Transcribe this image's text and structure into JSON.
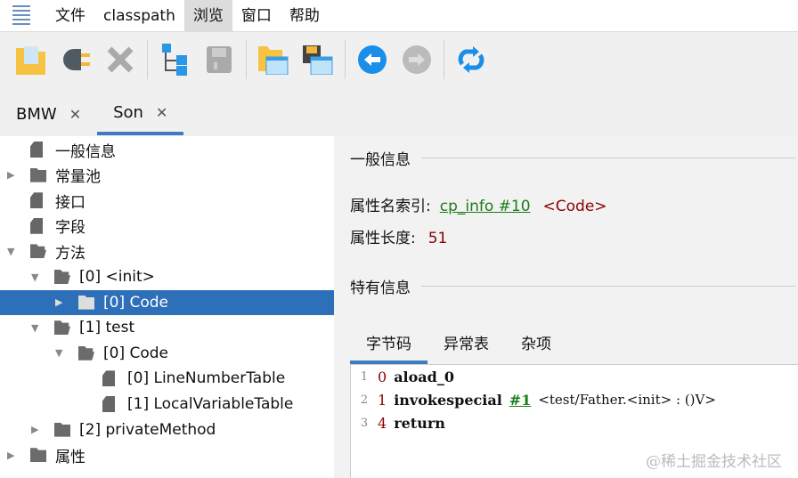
{
  "menu": [
    "文件",
    "classpath",
    "浏览",
    "窗口",
    "帮助"
  ],
  "toolbar": [
    "open-icon",
    "plug-icon",
    "close-icon",
    "tree-icon",
    "save-icon",
    "open-window-icon",
    "save-window-icon",
    "back-icon",
    "forward-icon",
    "refresh-icon"
  ],
  "tabs": [
    {
      "label": "BMW"
    },
    {
      "label": "Son"
    }
  ],
  "close_glyph": "✕",
  "tree": [
    {
      "label": "一般信息",
      "level": 0,
      "icon": "file",
      "arrow": ""
    },
    {
      "label": "常量池",
      "level": 0,
      "icon": "folder",
      "arrow": "▶"
    },
    {
      "label": "接口",
      "level": 0,
      "icon": "file",
      "arrow": ""
    },
    {
      "label": "字段",
      "level": 0,
      "icon": "file",
      "arrow": ""
    },
    {
      "label": "方法",
      "level": 0,
      "icon": "ofolder",
      "arrow": "▼"
    },
    {
      "label": "[0] <init>",
      "level": 1,
      "icon": "ofolder",
      "arrow": "▼"
    },
    {
      "label": "[0] Code",
      "level": 2,
      "icon": "folder",
      "arrow": "▶",
      "selected": true
    },
    {
      "label": "[1] test",
      "level": 1,
      "icon": "ofolder",
      "arrow": "▼"
    },
    {
      "label": "[0] Code",
      "level": 2,
      "icon": "ofolder",
      "arrow": "▼"
    },
    {
      "label": "[0] LineNumberTable",
      "level": 3,
      "icon": "file",
      "arrow": ""
    },
    {
      "label": "[1] LocalVariableTable",
      "level": 3,
      "icon": "file",
      "arrow": ""
    },
    {
      "label": "[2] privateMethod",
      "level": 1,
      "icon": "folder",
      "arrow": "▶"
    },
    {
      "label": "属性",
      "level": 0,
      "icon": "folder",
      "arrow": "▶"
    }
  ],
  "general": {
    "title": "一般信息",
    "name_index_label": "属性名索引:",
    "name_index_link": "cp_info #10",
    "name_index_value": "<Code>",
    "length_label": "属性长度:",
    "length_value": "51"
  },
  "specific": {
    "title": "特有信息"
  },
  "subtabs": [
    "字节码",
    "异常表",
    "杂项"
  ],
  "code": [
    {
      "line": "1",
      "offset": "0",
      "op": "aload_0",
      "ref": "",
      "comment": ""
    },
    {
      "line": "2",
      "offset": "1",
      "op": "invokespecial",
      "ref": "#1",
      "comment": "<test/Father.<init> : ()V>"
    },
    {
      "line": "3",
      "offset": "4",
      "op": "return",
      "ref": "",
      "comment": ""
    }
  ],
  "watermark": "@稀土掘金技术社区"
}
